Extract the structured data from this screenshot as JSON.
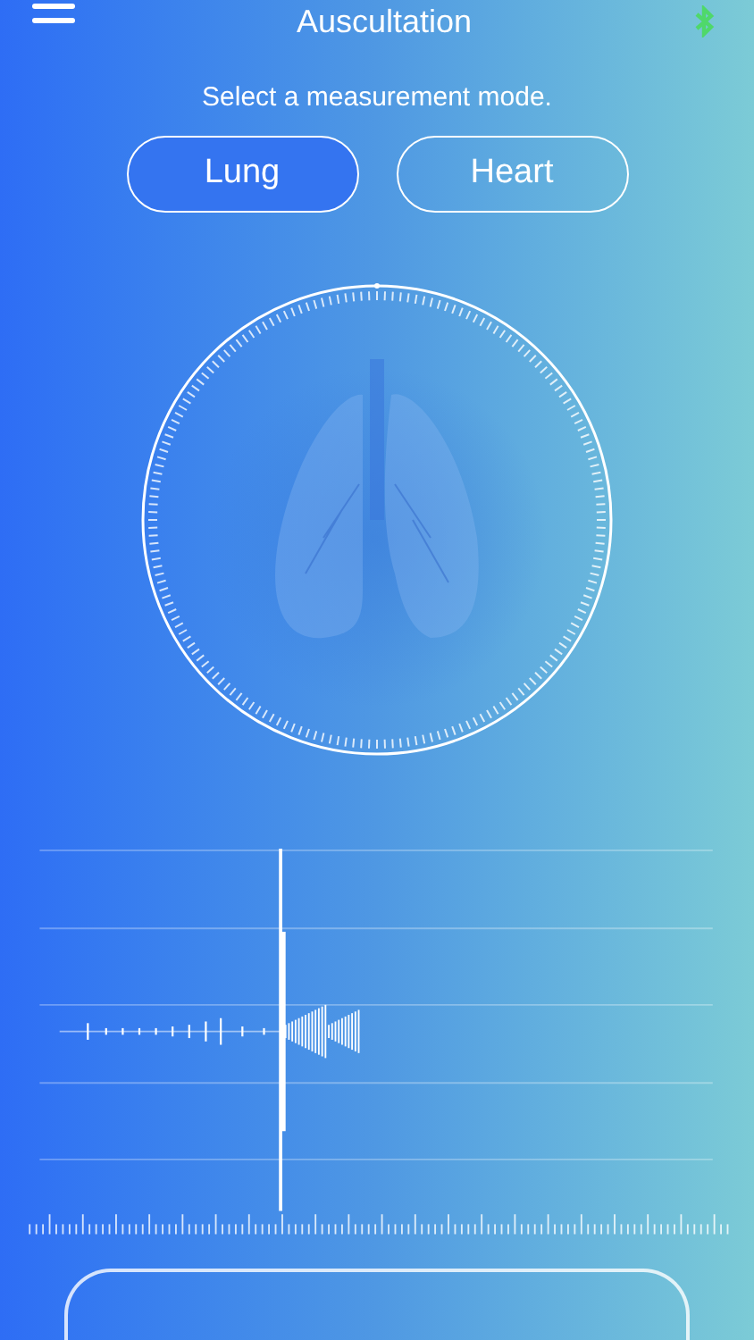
{
  "header": {
    "title": "Auscultation"
  },
  "prompt": "Select a measurement mode.",
  "modes": [
    {
      "label": "Lung",
      "selected": true
    },
    {
      "label": "Heart",
      "selected": false
    }
  ]
}
